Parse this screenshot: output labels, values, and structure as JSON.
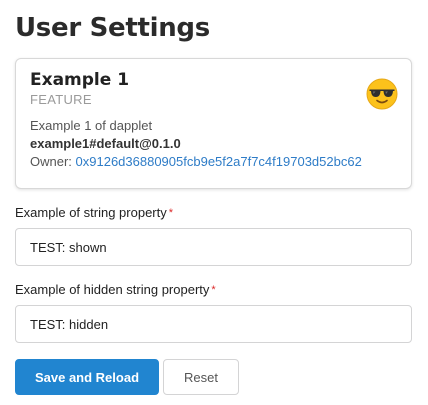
{
  "page": {
    "title": "User Settings"
  },
  "dapplet": {
    "name": "Example 1",
    "type": "FEATURE",
    "description": "Example 1 of dapplet",
    "version": "example1#default@0.1.0",
    "owner_label": "Owner:",
    "owner_address": "0x9126d36880905fcb9e5f2a7f7c4f19703d52bc62",
    "icon": "sunglasses-emoji-icon"
  },
  "fields": [
    {
      "label": "Example of string property",
      "required_mark": "*",
      "value": "TEST: shown"
    },
    {
      "label": "Example of hidden string property",
      "required_mark": "*",
      "value": "TEST: hidden"
    }
  ],
  "actions": {
    "save_label": "Save and Reload",
    "reset_label": "Reset"
  },
  "colors": {
    "primary": "#2185d0",
    "link": "#2e7cc7",
    "required": "#db2828"
  }
}
